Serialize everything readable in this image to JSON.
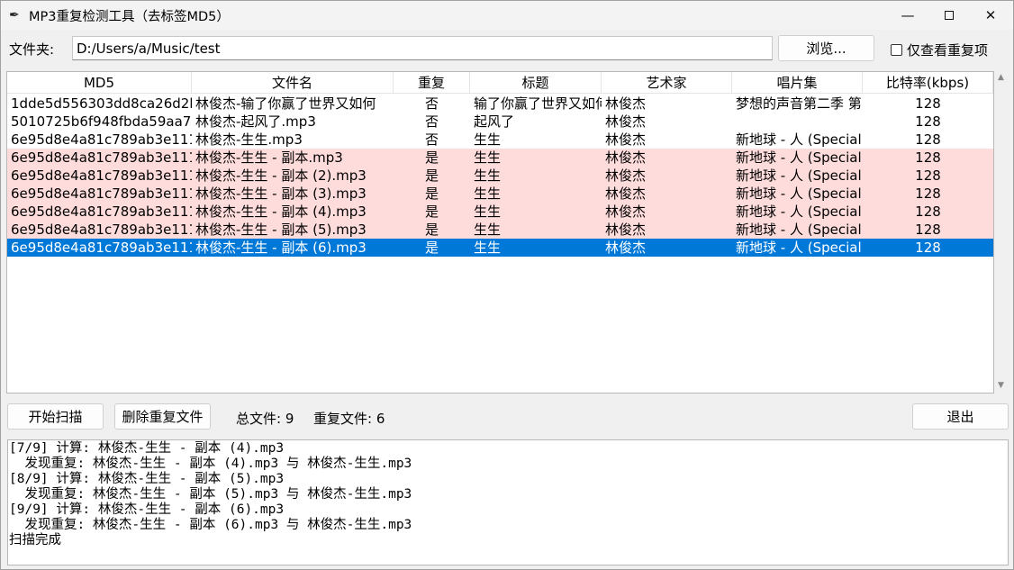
{
  "window": {
    "title": "MP3重复检测工具（去标签MD5）",
    "icon": "feather-icon"
  },
  "folder": {
    "label": "文件夹:",
    "path": "D:/Users/a/Music/test",
    "browse_label": "浏览...",
    "only_dup_label": "仅查看重复项",
    "only_dup_checked": false
  },
  "table": {
    "columns": [
      "MD5",
      "文件名",
      "重复",
      "标题",
      "艺术家",
      "唱片集",
      "比特率(kbps)"
    ],
    "rows": [
      {
        "md5": "1dde5d556303dd8ca26d2b",
        "file": "林俊杰-输了你赢了世界又如何",
        "dup": "否",
        "title": "输了你赢了世界又如何",
        "artist": "林俊杰",
        "album": "梦想的声音第二季 第",
        "bitrate": "128",
        "state": "normal"
      },
      {
        "md5": "5010725b6f948fbda59aa7c",
        "file": "林俊杰-起风了.mp3",
        "dup": "否",
        "title": "起风了",
        "artist": "林俊杰",
        "album": "",
        "bitrate": "128",
        "state": "normal"
      },
      {
        "md5": "6e95d8e4a81c789ab3e111",
        "file": "林俊杰-生生.mp3",
        "dup": "否",
        "title": "生生",
        "artist": "林俊杰",
        "album": "新地球 - 人 (Special",
        "bitrate": "128",
        "state": "normal"
      },
      {
        "md5": "6e95d8e4a81c789ab3e111",
        "file": "林俊杰-生生 - 副本.mp3",
        "dup": "是",
        "title": "生生",
        "artist": "林俊杰",
        "album": "新地球 - 人 (Special",
        "bitrate": "128",
        "state": "dup"
      },
      {
        "md5": "6e95d8e4a81c789ab3e111",
        "file": "林俊杰-生生 - 副本 (2).mp3",
        "dup": "是",
        "title": "生生",
        "artist": "林俊杰",
        "album": "新地球 - 人 (Special",
        "bitrate": "128",
        "state": "dup"
      },
      {
        "md5": "6e95d8e4a81c789ab3e111",
        "file": "林俊杰-生生 - 副本 (3).mp3",
        "dup": "是",
        "title": "生生",
        "artist": "林俊杰",
        "album": "新地球 - 人 (Special",
        "bitrate": "128",
        "state": "dup"
      },
      {
        "md5": "6e95d8e4a81c789ab3e111",
        "file": "林俊杰-生生 - 副本 (4).mp3",
        "dup": "是",
        "title": "生生",
        "artist": "林俊杰",
        "album": "新地球 - 人 (Special",
        "bitrate": "128",
        "state": "dup"
      },
      {
        "md5": "6e95d8e4a81c789ab3e111",
        "file": "林俊杰-生生 - 副本 (5).mp3",
        "dup": "是",
        "title": "生生",
        "artist": "林俊杰",
        "album": "新地球 - 人 (Special",
        "bitrate": "128",
        "state": "dup"
      },
      {
        "md5": "6e95d8e4a81c789ab3e111",
        "file": "林俊杰-生生 - 副本 (6).mp3",
        "dup": "是",
        "title": "生生",
        "artist": "林俊杰",
        "album": "新地球 - 人 (Special",
        "bitrate": "128",
        "state": "selected"
      }
    ]
  },
  "controls": {
    "scan_label": "开始扫描",
    "delete_label": "删除重复文件",
    "total_text": "总文件: 9",
    "dup_text": "重复文件: 6",
    "exit_label": "退出"
  },
  "log": [
    "[7/9] 计算: 林俊杰-生生 - 副本 (4).mp3",
    "  发现重复: 林俊杰-生生 - 副本 (4).mp3 与 林俊杰-生生.mp3",
    "[8/9] 计算: 林俊杰-生生 - 副本 (5).mp3",
    "  发现重复: 林俊杰-生生 - 副本 (5).mp3 与 林俊杰-生生.mp3",
    "[9/9] 计算: 林俊杰-生生 - 副本 (6).mp3",
    "  发现重复: 林俊杰-生生 - 副本 (6).mp3 与 林俊杰-生生.mp3",
    "扫描完成"
  ],
  "colors": {
    "dup_row": "#ffdcdc",
    "selected_row": "#0078d7"
  }
}
